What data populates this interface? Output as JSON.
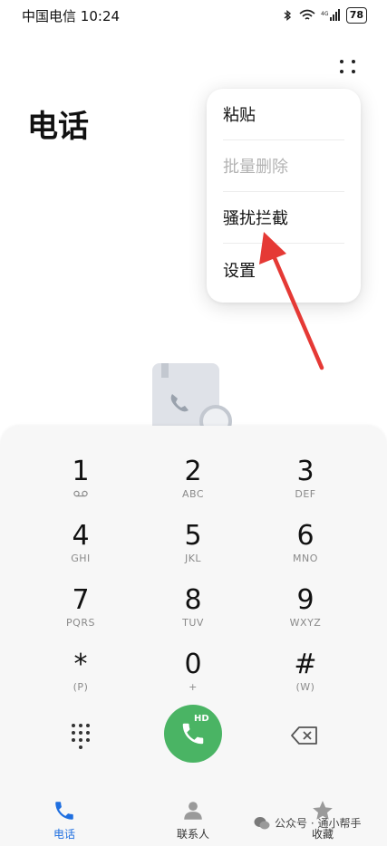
{
  "status": {
    "carrier": "中国电信",
    "time": "10:24",
    "signal_label": "4G",
    "battery": "78"
  },
  "header": {
    "title": "电话",
    "more_icon": "more-dots-icon"
  },
  "menu": {
    "items": [
      {
        "label": "粘贴",
        "enabled": true
      },
      {
        "label": "批量删除",
        "enabled": false
      },
      {
        "label": "骚扰拦截",
        "enabled": true
      },
      {
        "label": "设置",
        "enabled": true
      }
    ]
  },
  "annotation": {
    "arrow_color": "#e53935"
  },
  "dialpad": {
    "keys": [
      {
        "digit": "1",
        "letters": ""
      },
      {
        "digit": "2",
        "letters": "ABC"
      },
      {
        "digit": "3",
        "letters": "DEF"
      },
      {
        "digit": "4",
        "letters": "GHI"
      },
      {
        "digit": "5",
        "letters": "JKL"
      },
      {
        "digit": "6",
        "letters": "MNO"
      },
      {
        "digit": "7",
        "letters": "PQRS"
      },
      {
        "digit": "8",
        "letters": "TUV"
      },
      {
        "digit": "9",
        "letters": "WXYZ"
      },
      {
        "digit": "*",
        "letters": "(P)"
      },
      {
        "digit": "0",
        "letters": "+"
      },
      {
        "digit": "#",
        "letters": "(W)"
      }
    ],
    "call_badge": "HD",
    "call_color": "#4ab464"
  },
  "nav": {
    "items": [
      {
        "label": "电话",
        "icon": "phone-icon",
        "active": true
      },
      {
        "label": "联系人",
        "icon": "contacts-icon",
        "active": false
      },
      {
        "label": "收藏",
        "icon": "star-icon",
        "active": false
      }
    ],
    "active_color": "#1f6fe0"
  },
  "watermark": {
    "text": "公众号 · 通小帮手"
  }
}
